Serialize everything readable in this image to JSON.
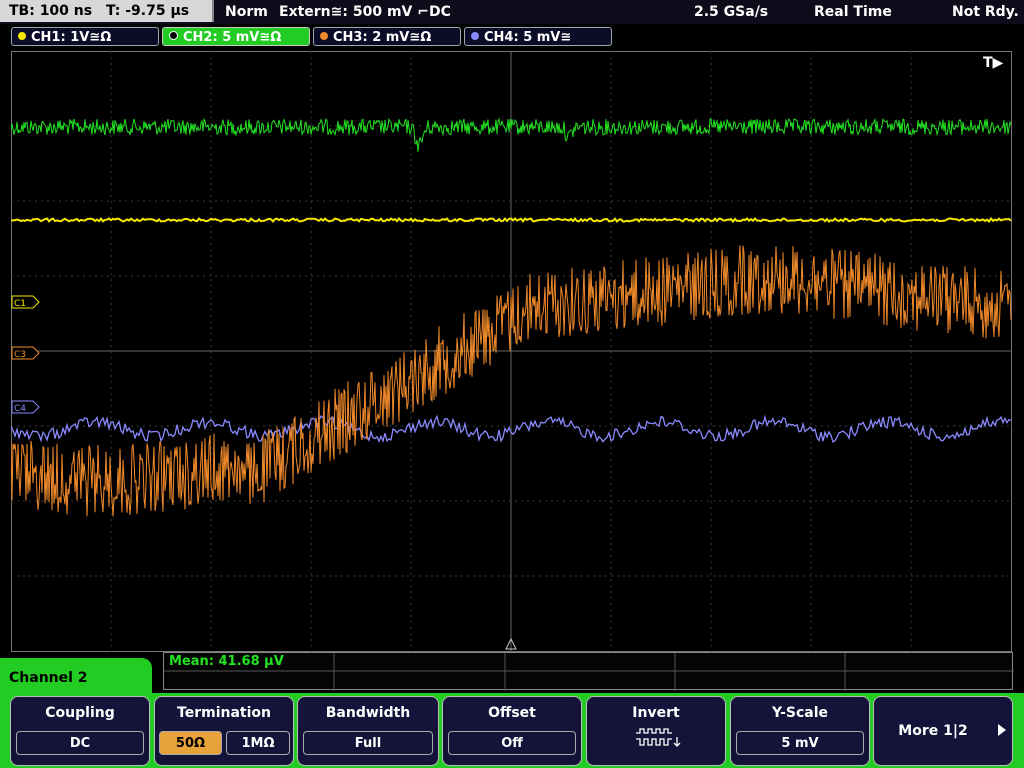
{
  "status_bar": {
    "timebase": "TB: 100 ns",
    "trigger_time": "T: -9.75 µs",
    "trigger_mode": "Norm",
    "trigger_source": "Extern≅: 500 mV ⌐DC",
    "sample_rate": "2.5 GSa/s",
    "acq_mode": "Real Time",
    "status": "Not Rdy."
  },
  "channels": [
    {
      "label": "CH1: 1V≅Ω",
      "color": "#f5e800"
    },
    {
      "label": "CH2: 5 mV≅Ω",
      "color": "#22e322"
    },
    {
      "label": "CH3: 2 mV≅Ω",
      "color": "#f08a2a"
    },
    {
      "label": "CH4: 5 mV≅",
      "color": "#8a8aff"
    }
  ],
  "markers": {
    "c1": "C1",
    "c3": "C3",
    "c4": "C4",
    "trigger": "T▶"
  },
  "measurement": {
    "text": "Mean: 41.68 µV"
  },
  "menu": {
    "title": "Channel 2",
    "softkeys": {
      "coupling_title": "Coupling",
      "coupling_value": "DC",
      "termination_title": "Termination",
      "term_50": "50Ω",
      "term_1m": "1MΩ",
      "bandwidth_title": "Bandwidth",
      "bandwidth_value": "Full",
      "offset_title": "Offset",
      "offset_value": "Off",
      "invert_title": "Invert",
      "yscale_title": "Y-Scale",
      "yscale_value": "5 mV",
      "more_label": "More 1|2"
    }
  },
  "colors": {
    "accent_green": "#22cc22",
    "ch1": "#f5e800",
    "ch2": "#22e322",
    "ch3": "#f08a2a",
    "ch4": "#8a8aff"
  }
}
